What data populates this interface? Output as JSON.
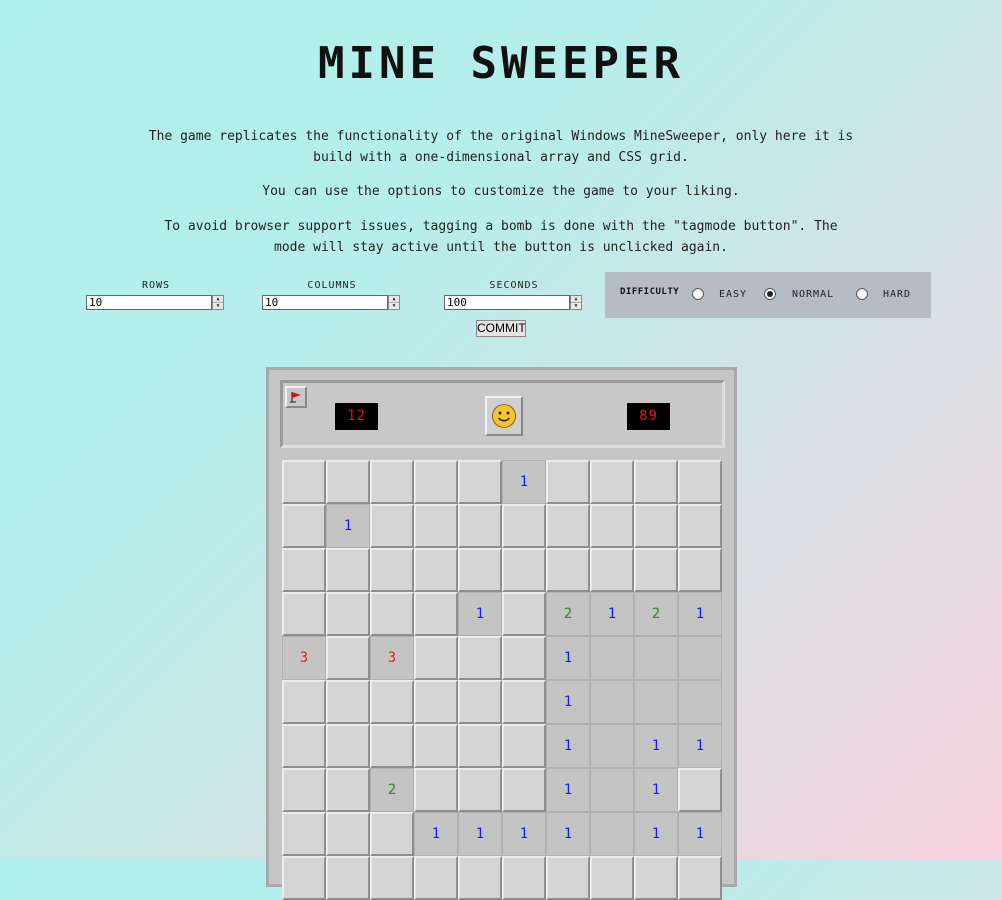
{
  "title": "MINE SWEEPER",
  "description": [
    "The game replicates the functionality of the original Windows MineSweeper, only here it is build with a one-dimensional array and CSS grid.",
    "You can use the options to customize the game to your liking.",
    "To avoid browser support issues, tagging a bomb is done with the \"tagmode button\". The mode will stay active until the button is unclicked again."
  ],
  "options": {
    "rows": {
      "label": "ROWS",
      "value": "10"
    },
    "columns": {
      "label": "COLUMNS",
      "value": "10"
    },
    "seconds": {
      "label": "SECONDS",
      "value": "100"
    },
    "commit_label": "COMMIT"
  },
  "difficulty": {
    "label": "DIFFICULTY",
    "options": [
      "EASY",
      "NORMAL",
      "HARD"
    ],
    "selected": "NORMAL"
  },
  "game": {
    "mines_counter": "12",
    "timer": "89",
    "face": "smiley-face-icon",
    "tag_button_icon": "flag-icon",
    "board": [
      [
        "C",
        "C",
        "C",
        "C",
        "C",
        "1",
        "C",
        "C",
        "C",
        "C"
      ],
      [
        "C",
        "1",
        "C",
        "C",
        "C",
        "C",
        "C",
        "C",
        "C",
        "C"
      ],
      [
        "C",
        "C",
        "C",
        "C",
        "C",
        "C",
        "C",
        "C",
        "C",
        "C"
      ],
      [
        "C",
        "C",
        "C",
        "C",
        "1",
        "C",
        "2",
        "1",
        "2",
        "1"
      ],
      [
        "3",
        "C",
        "3",
        "C",
        "C",
        "C",
        "1",
        "",
        "",
        ""
      ],
      [
        "C",
        "C",
        "C",
        "C",
        "C",
        "C",
        "1",
        "",
        "",
        ""
      ],
      [
        "C",
        "C",
        "C",
        "C",
        "C",
        "C",
        "1",
        "",
        "1",
        "1"
      ],
      [
        "C",
        "C",
        "2",
        "C",
        "C",
        "C",
        "1",
        "",
        "1",
        "C"
      ],
      [
        "C",
        "C",
        "C",
        "1",
        "1",
        "1",
        "1",
        "",
        "1",
        "1"
      ],
      [
        "C",
        "C",
        "C",
        "C",
        "C",
        "C",
        "C",
        "C",
        "C",
        "C"
      ]
    ],
    "number_colors": {
      "1": "#1a1aff",
      "2": "#1c8a1c",
      "3": "#ee1c1c"
    }
  },
  "colors": {
    "counter_bg": "#000000",
    "counter_text": "#e8101a",
    "panel_bg": "#b5bcc2"
  }
}
